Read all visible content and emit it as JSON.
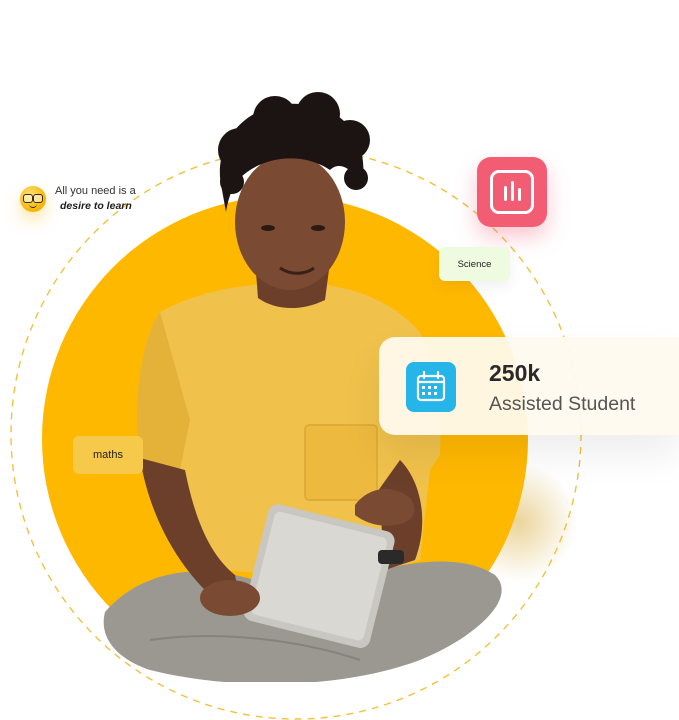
{
  "colors": {
    "accent_yellow": "#FFB800",
    "chart_tile": "#F25D73",
    "calendar_tile": "#25B5E8",
    "science_tag_bg": "#EEFBE0",
    "maths_tag_bg": "#F6C94A",
    "ring_dashes": "#F2C13C"
  },
  "motto": {
    "line1": "All you need is a",
    "line2": "desire to learn",
    "icon": "nerd-face-emoji-icon"
  },
  "tags": {
    "science": "Science",
    "maths": "maths"
  },
  "chart_tile": {
    "icon": "bar-chart-icon"
  },
  "stat_card": {
    "icon": "calendar-icon",
    "value": "250k",
    "label": "Assisted Student"
  },
  "hero": {
    "subject": "student-with-tablet"
  }
}
